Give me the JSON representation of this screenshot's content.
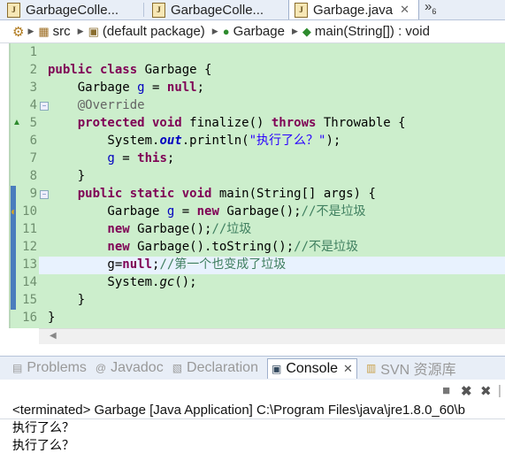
{
  "tabs": [
    {
      "label": "GarbageColle...",
      "active": false
    },
    {
      "label": "GarbageColle...",
      "active": false
    },
    {
      "label": "Garbage.java",
      "active": true,
      "close": "✕"
    }
  ],
  "tab_overflow": {
    "symbol": "»",
    "count": "6"
  },
  "breadcrumb": [
    {
      "label": "src",
      "icon": "source-folder-icon"
    },
    {
      "label": "(default package)",
      "icon": "package-icon"
    },
    {
      "label": "Garbage",
      "icon": "class-icon"
    },
    {
      "label": "main(String[]) : void",
      "icon": "method-icon"
    }
  ],
  "line_numbers": [
    "1",
    "2",
    "3",
    "4",
    "5",
    "6",
    "7",
    "8",
    "9",
    "10",
    "11",
    "12",
    "13",
    "14",
    "15",
    "16"
  ],
  "code": {
    "l2_kw": "public class",
    "l2_rest": " Garbage {",
    "l3_type": "    Garbage ",
    "l3_field": "g",
    "l3_eq": " = ",
    "l3_kw": "null",
    "l3_end": ";",
    "l4_ann": "    @Override",
    "l5_kw": "    protected void",
    "l5_mid": " finalize() ",
    "l5_kw2": "throws",
    "l5_rest": " Throwable {",
    "l6_a": "        System.",
    "l6_out": "out",
    "l6_b": ".println(",
    "l6_str": "\"执行了么？\"",
    "l6_c": ");",
    "l7_field": "        g",
    "l7_eq": " = ",
    "l7_kw": "this",
    "l7_end": ";",
    "l8": "    }",
    "l9_kw": "    public static void",
    "l9_rest": " main(String[] args) {",
    "l10_a": "        Garbage ",
    "l10_field": "g",
    "l10_eq": " = ",
    "l10_kw": "new",
    "l10_b": " Garbage();",
    "l10_cmt": "//不是垃圾",
    "l11_kw": "        new",
    "l11_b": " Garbage();",
    "l11_cmt": "//垃圾",
    "l12_kw": "        new",
    "l12_b": " Garbage().toString();",
    "l12_cmt": "//不是垃圾",
    "l13_a": "        g=",
    "l13_kw": "null",
    "l13_b": ";",
    "l13_cmt": "//第一个也变成了垃圾",
    "l14_a": "        System.",
    "l14_gc": "gc",
    "l14_b": "();",
    "l15": "    }",
    "l16": "}"
  },
  "views": [
    {
      "label": "Problems",
      "active": false
    },
    {
      "label": "Javadoc",
      "active": false
    },
    {
      "label": "Declaration",
      "active": false
    },
    {
      "label": "Console",
      "active": true,
      "close": "✕"
    },
    {
      "label": "SVN 资源库",
      "active": false
    }
  ],
  "console": {
    "status": "<terminated> Garbage [Java Application] C:\\Program Files\\java\\jre1.8.0_60\\b",
    "output": [
      "执行了么？",
      "执行了么？"
    ]
  },
  "colors": {
    "editor_bg": "#cceecc",
    "keyword": "#7f0055",
    "string": "#2a00ff",
    "comment": "#3f7f5f",
    "field": "#0000c0"
  }
}
